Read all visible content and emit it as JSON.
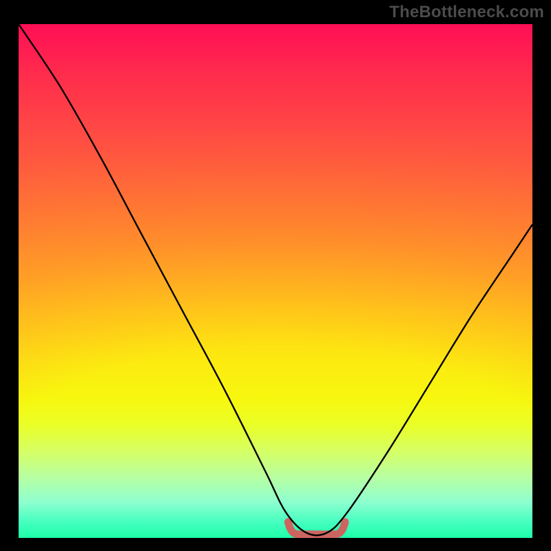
{
  "watermark": "TheBottleneck.com",
  "chart_data": {
    "type": "line",
    "title": "",
    "xlabel": "",
    "ylabel": "",
    "xlim": [
      0,
      100
    ],
    "ylim": [
      0,
      100
    ],
    "series": [
      {
        "name": "bottleneck-curve",
        "x": [
          0,
          8,
          16,
          24,
          32,
          40,
          48,
          52,
          56,
          60,
          64,
          72,
          80,
          88,
          96,
          100
        ],
        "values": [
          100,
          88,
          74,
          59,
          44,
          29,
          13,
          5,
          1,
          1,
          5,
          17,
          30,
          43,
          55,
          61
        ]
      }
    ],
    "annotations": [
      {
        "name": "flat-minimum-band",
        "x_start": 53,
        "x_end": 63,
        "y": 0.7
      }
    ],
    "gradient_stops": [
      {
        "pos": 0.0,
        "color": "#ff144c"
      },
      {
        "pos": 0.5,
        "color": "#ffc518"
      },
      {
        "pos": 0.75,
        "color": "#f7f70f"
      },
      {
        "pos": 1.0,
        "color": "#1effa8"
      }
    ]
  }
}
